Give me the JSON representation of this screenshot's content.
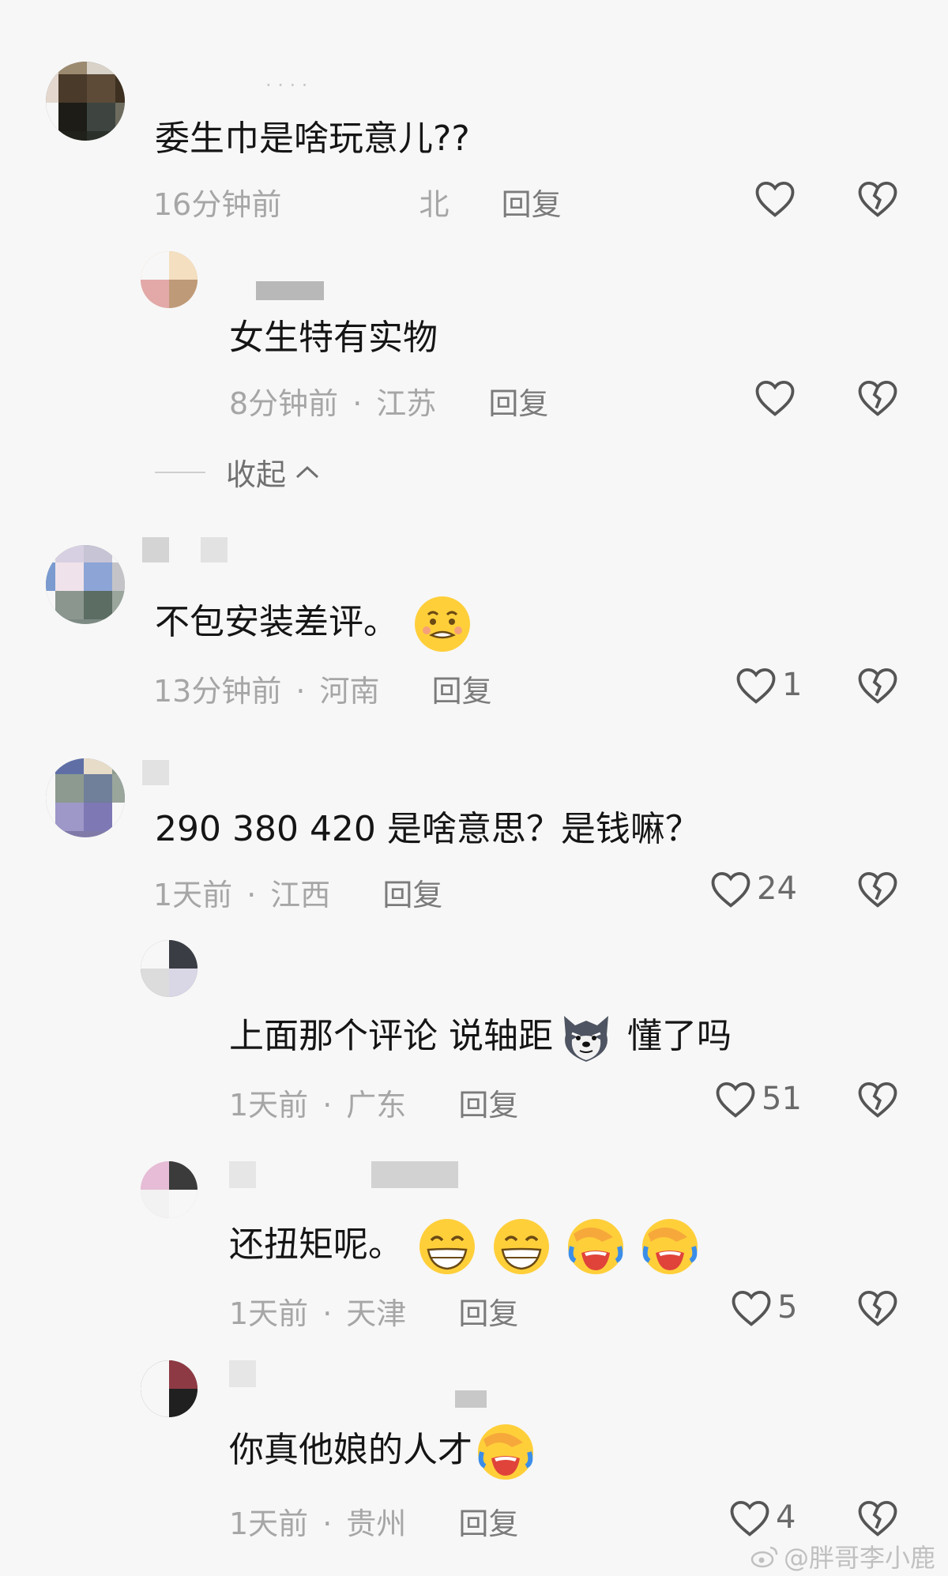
{
  "comments": [
    {
      "text": "委生巾是啥玩意儿??",
      "time": "16分钟前",
      "location": "北",
      "reply": "回复",
      "likes": ""
    },
    {
      "text": "女生特有实物",
      "time": "8分钟前",
      "location": "江苏",
      "reply": "回复",
      "likes": ""
    },
    {
      "text": "不包安装差评。",
      "time": "13分钟前",
      "location": "河南",
      "reply": "回复",
      "likes": "1"
    },
    {
      "text": "290  380  420  是啥意思？是钱嘛？",
      "time": "1天前",
      "location": "江西",
      "reply": "回复",
      "likes": "24"
    },
    {
      "text_before": "上面那个评论 说轴距",
      "text_after": " 懂了吗",
      "time": "1天前",
      "location": "广东",
      "reply": "回复",
      "likes": "51"
    },
    {
      "text": "还扭矩呢。",
      "time": "1天前",
      "location": "天津",
      "reply": "回复",
      "likes": "5"
    },
    {
      "text": "你真他娘的人才",
      "time": "1天前",
      "location": "贵州",
      "reply": "回复",
      "likes": "4"
    }
  ],
  "collapse_label": "收起",
  "watermark": "@胖哥李小鹿",
  "colors": {
    "background": "#f7f7f7",
    "text": "#151515",
    "meta": "#a6a6a6",
    "reply": "#7b7b7b",
    "icon": "#555555"
  }
}
